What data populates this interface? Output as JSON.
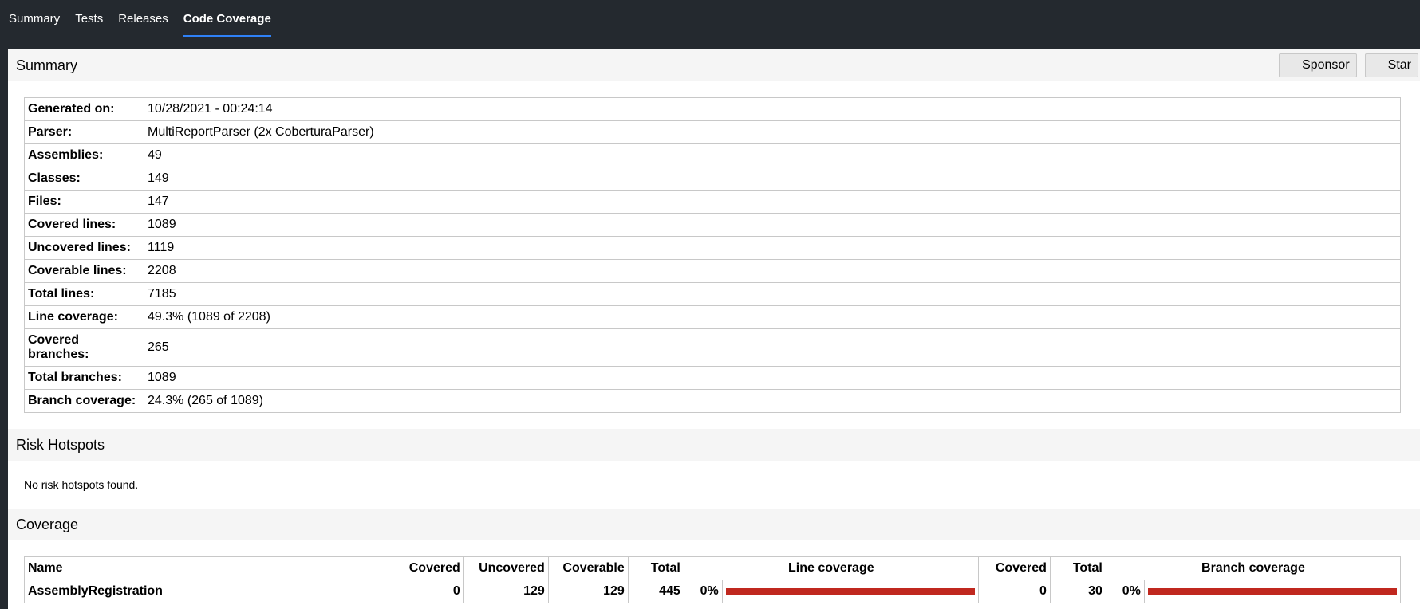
{
  "nav": {
    "tabs": [
      {
        "label": "Summary"
      },
      {
        "label": "Tests"
      },
      {
        "label": "Releases"
      },
      {
        "label": "Code Coverage",
        "active": true
      }
    ]
  },
  "summary": {
    "title": "Summary",
    "sponsor_label": "Sponsor",
    "star_label": "Star",
    "rows": [
      {
        "key": "Generated on:",
        "value": "10/28/2021 - 00:24:14"
      },
      {
        "key": "Parser:",
        "value": "MultiReportParser (2x CoberturaParser)"
      },
      {
        "key": "Assemblies:",
        "value": "49"
      },
      {
        "key": "Classes:",
        "value": "149"
      },
      {
        "key": "Files:",
        "value": "147"
      },
      {
        "key": "Covered lines:",
        "value": "1089"
      },
      {
        "key": "Uncovered lines:",
        "value": "1119"
      },
      {
        "key": "Coverable lines:",
        "value": "2208"
      },
      {
        "key": "Total lines:",
        "value": "7185"
      },
      {
        "key": "Line coverage:",
        "value": "49.3% (1089 of 2208)"
      },
      {
        "key": "Covered branches:",
        "value": "265"
      },
      {
        "key": "Total branches:",
        "value": "1089"
      },
      {
        "key": "Branch coverage:",
        "value": "24.3% (265 of 1089)"
      }
    ]
  },
  "risk": {
    "title": "Risk Hotspots",
    "message": "No risk hotspots found."
  },
  "coverage": {
    "title": "Coverage",
    "headers": {
      "name": "Name",
      "covered": "Covered",
      "uncovered": "Uncovered",
      "coverable": "Coverable",
      "total": "Total",
      "line_coverage": "Line coverage",
      "branch_covered": "Covered",
      "branch_total": "Total",
      "branch_coverage": "Branch coverage"
    },
    "rows": [
      {
        "name": "AssemblyRegistration",
        "covered": "0",
        "uncovered": "129",
        "coverable": "129",
        "total": "445",
        "line_pct": "0%",
        "line_fraction": 0,
        "branch_covered": "0",
        "branch_total": "30",
        "branch_pct": "0%",
        "branch_fraction": 0
      }
    ],
    "bar_color": "#c0281f"
  }
}
